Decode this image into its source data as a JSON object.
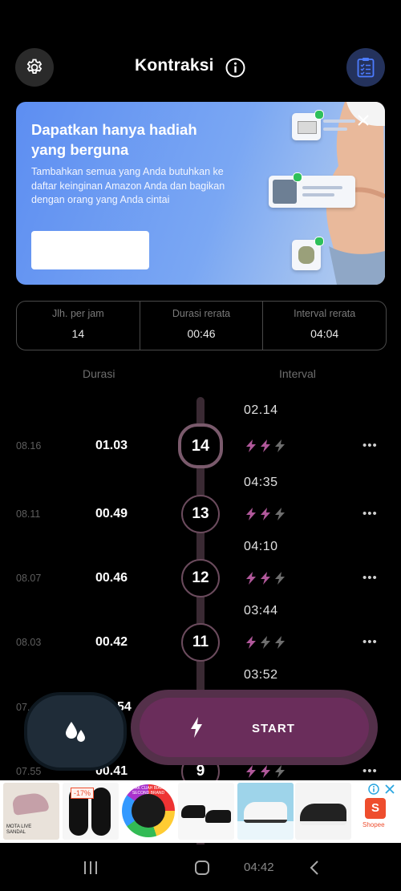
{
  "header": {
    "title": "Kontraksi",
    "settings_icon": "gear-icon",
    "info_icon": "info-icon",
    "checklist_icon": "checklist-icon"
  },
  "banner": {
    "headline": "Dapatkan hanya hadiah yang berguna",
    "body": "Tambahkan semua yang Anda butuhkan ke daftar keinginan Amazon Anda dan bagikan dengan orang yang Anda cintai",
    "cta_label": ""
  },
  "stats": [
    {
      "label": "Jlh. per jam",
      "value": "14"
    },
    {
      "label": "Durasi rerata",
      "value": "00:46"
    },
    {
      "label": "Interval rerata",
      "value": "04:04"
    }
  ],
  "columns": {
    "duration": "Durasi",
    "interval": "Interval"
  },
  "interval_labels": [
    "02.14",
    "04:35",
    "04:10",
    "03:44",
    "03:52"
  ],
  "contractions": [
    {
      "time": "08.16",
      "duration": "01.03",
      "number": "14",
      "intensity": 2
    },
    {
      "time": "08.11",
      "duration": "00.49",
      "number": "13",
      "intensity": 2
    },
    {
      "time": "08.07",
      "duration": "00.46",
      "number": "12",
      "intensity": 2
    },
    {
      "time": "08.03",
      "duration": "00.42",
      "number": "11",
      "intensity": 1
    },
    {
      "time": "07.",
      "duration": "54",
      "number": "",
      "intensity": 0
    },
    {
      "time": "07.55",
      "duration": "00.41",
      "number": "9",
      "intensity": 2
    }
  ],
  "more_label": "•••",
  "actions": {
    "water_icon": "water-drops-icon",
    "start_label": "START",
    "start_icon": "lightning-icon"
  },
  "ad": {
    "badge_percent": "-17%",
    "labels": [
      "MOTA LIVE SANDAL",
      "TAPAK CUAH BIAWAS SECOND BRAND"
    ],
    "brand": "Shopee"
  },
  "navbar": {
    "time": "04:42"
  },
  "colors": {
    "accent": "#b0589a",
    "inactive_bolt": "#6e6e6e",
    "banner": "#6a98f2"
  }
}
